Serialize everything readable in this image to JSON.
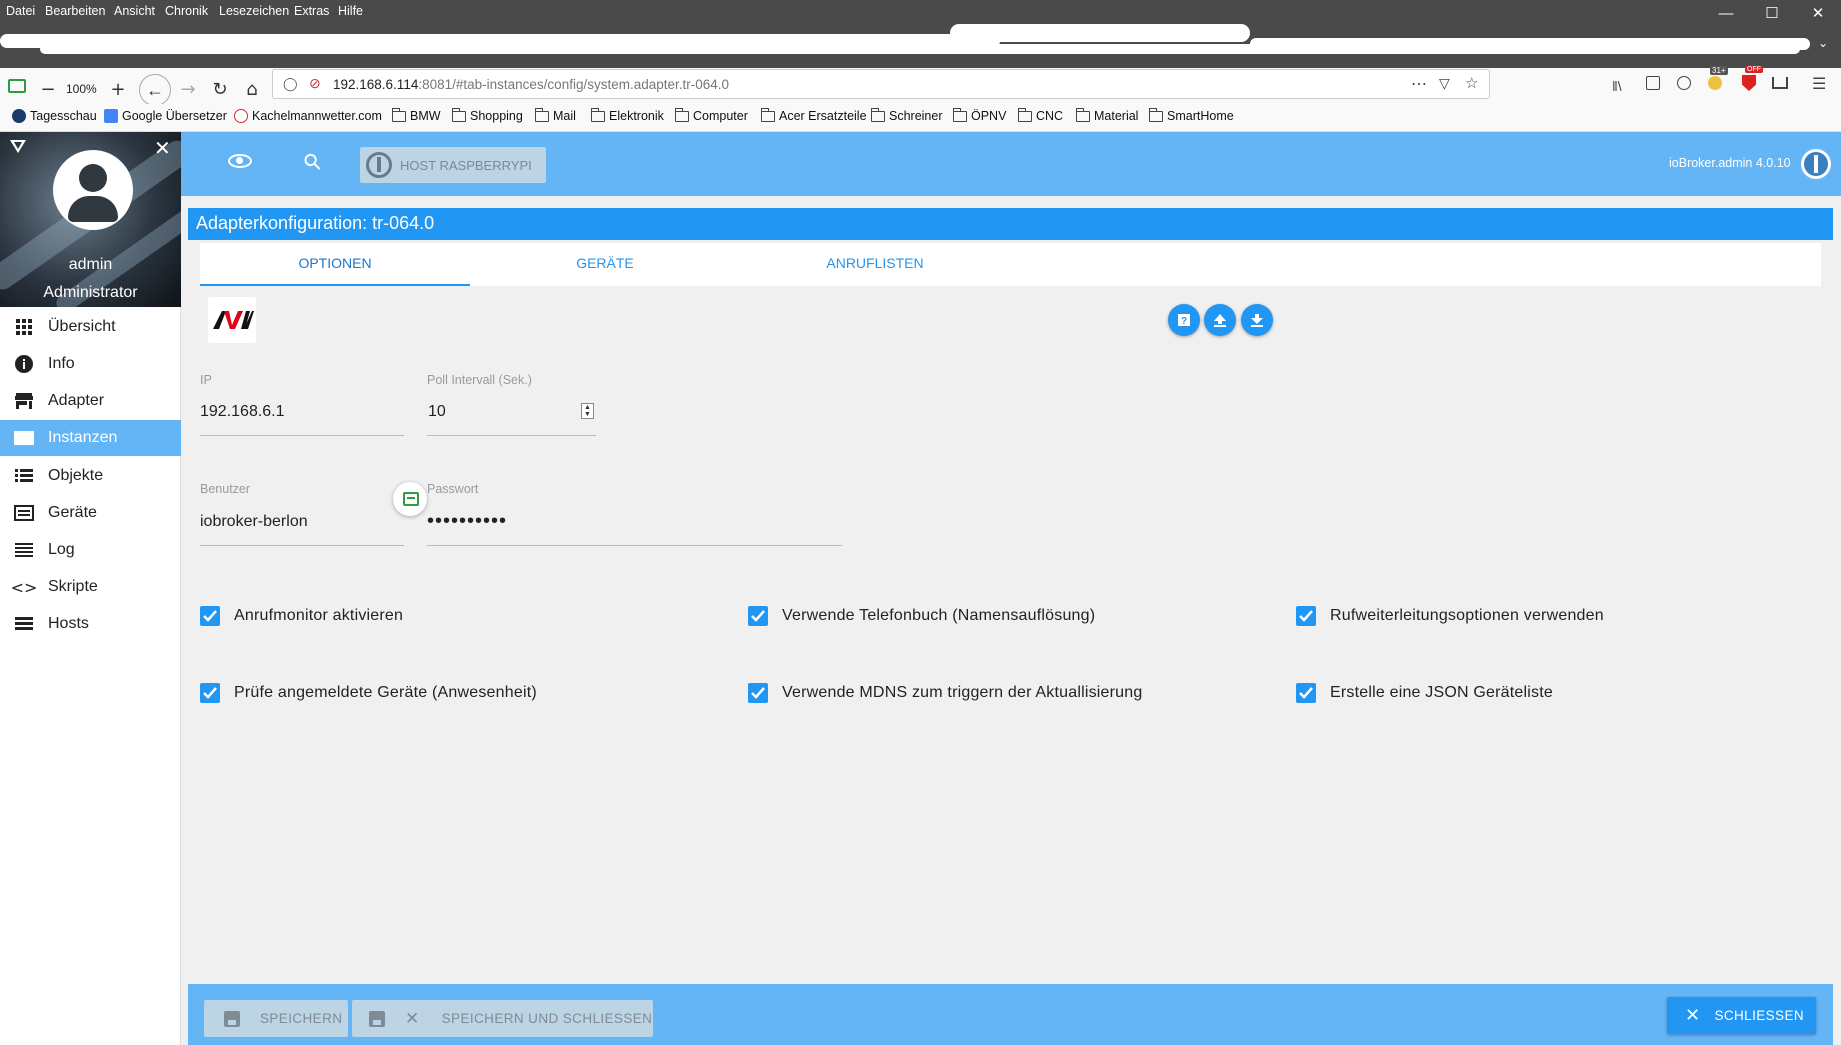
{
  "browser": {
    "menu": [
      "Datei",
      "Bearbeiten",
      "Ansicht",
      "Chronik",
      "Lesezeichen",
      "Extras",
      "Hilfe"
    ],
    "zoom": "100%",
    "url_host": "192.168.6.114",
    "url_rest": ":8081/#tab-instances/config/system.adapter.tr-064.0",
    "bookmarks": [
      "Tagesschau",
      "Google Übersetzer",
      "Kachelmannwetter.com",
      "BMW",
      "Shopping",
      "Mail",
      "Elektronik",
      "Computer",
      "Acer Ersatzteile",
      "Schreiner",
      "ÖPNV",
      "CNC",
      "Material",
      "SmartHome"
    ],
    "badge_count": "31+",
    "badge_off": "OFF"
  },
  "sidebar": {
    "user": "admin",
    "role": "Administrator",
    "items": [
      {
        "label": "Übersicht",
        "icon": "grid-icon"
      },
      {
        "label": "Info",
        "icon": "info-icon"
      },
      {
        "label": "Adapter",
        "icon": "store-icon"
      },
      {
        "label": "Instanzen",
        "icon": "instances-icon",
        "active": true
      },
      {
        "label": "Objekte",
        "icon": "list-icon"
      },
      {
        "label": "Geräte",
        "icon": "devices-icon"
      },
      {
        "label": "Log",
        "icon": "log-icon"
      },
      {
        "label": "Skripte",
        "icon": "code-icon"
      },
      {
        "label": "Hosts",
        "icon": "hosts-icon"
      }
    ]
  },
  "header": {
    "host_button": "HOST RASPBERRYPI",
    "version": "ioBroker.admin 4.0.10"
  },
  "dialog": {
    "title": "Adapterkonfiguration: tr-064.0",
    "tabs": [
      "OPTIONEN",
      "GERÄTE",
      "ANRUFLISTEN"
    ],
    "fields": {
      "ip_label": "IP",
      "ip_value": "192.168.6.1",
      "poll_label": "Poll Intervall (Sek.)",
      "poll_value": "10",
      "user_label": "Benutzer",
      "user_value": "iobroker-berlon",
      "password_label": "Passwort",
      "password_value": "••••••••••"
    },
    "checkboxes": [
      {
        "label": "Anrufmonitor aktivieren",
        "checked": true
      },
      {
        "label": "Verwende Telefonbuch (Namensauflösung)",
        "checked": true
      },
      {
        "label": "Rufweiterleitungsoptionen verwenden",
        "checked": true
      },
      {
        "label": "Prüfe angemeldete Geräte (Anwesenheit)",
        "checked": true
      },
      {
        "label": "Verwende MDNS zum triggern der Aktuallisierung",
        "checked": true
      },
      {
        "label": "Erstelle eine JSON Geräteliste",
        "checked": true
      }
    ],
    "footer": {
      "save": "SPEICHERN",
      "save_close": "SPEICHERN UND SCHLIESSEN",
      "close": "SCHLIESSEN"
    }
  },
  "colors": {
    "primary": "#2196f3",
    "header": "#64b5f6",
    "disabled_button": "#bdd4e4"
  }
}
